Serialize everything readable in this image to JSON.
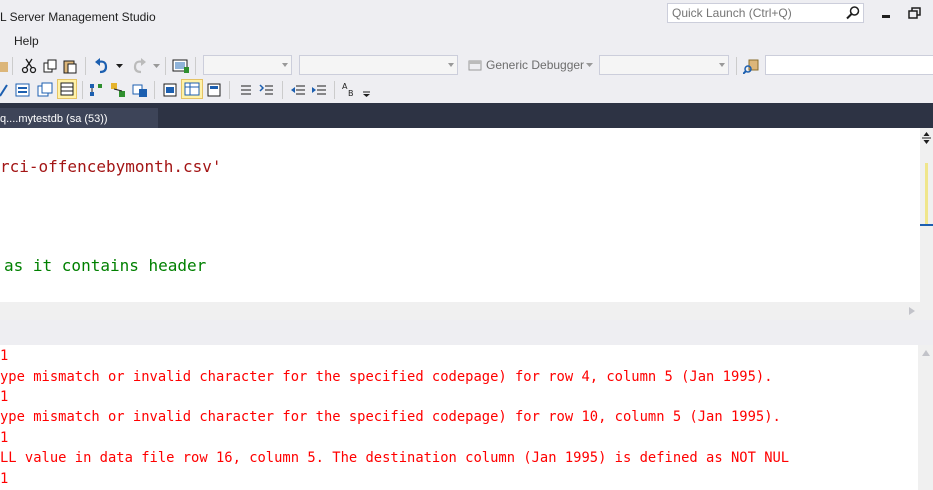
{
  "window": {
    "title": "L Server Management Studio",
    "quick_launch_placeholder": "Quick Launch (Ctrl+Q)"
  },
  "menu": {
    "items": [
      "Help"
    ]
  },
  "toolbar": {
    "debugger_label": "Generic Debugger"
  },
  "tab": {
    "label": "q....mytestdb (sa (53))"
  },
  "editor": {
    "lines": [
      "rci-offencebymonth.csv'",
      "as it contains header"
    ]
  },
  "messages": {
    "lines": [
      "1",
      "ype mismatch or invalid character for the specified codepage) for row 4, column 5 (Jan 1995).",
      "1",
      "ype mismatch or invalid character for the specified codepage) for row 10, column 5 (Jan 1995).",
      "1",
      "LL value in data file row 16, column 5. The destination column (Jan 1995) is defined as NOT NUL",
      "1"
    ]
  },
  "colors": {
    "tabstrip": "#2d3344",
    "string": "#a31515",
    "comment": "#008000",
    "error": "#ff0000"
  }
}
